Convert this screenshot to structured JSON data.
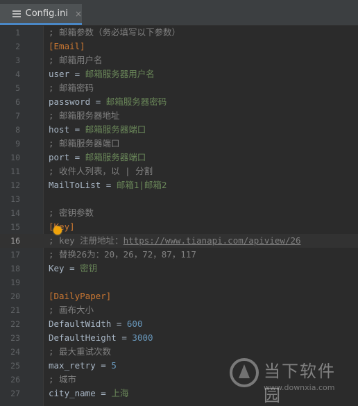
{
  "tab": {
    "title": "Config.ini",
    "close": "×",
    "icon": "ini-file-icon"
  },
  "editor": {
    "current_line": 16,
    "lines": [
      {
        "n": "1",
        "comment": "; 邮箱参数（务必填写以下参数）"
      },
      {
        "n": "2",
        "section": "[Email]"
      },
      {
        "n": "3",
        "comment": "; 邮箱用户名"
      },
      {
        "n": "4",
        "key": "user",
        "eq": " = ",
        "val": "邮箱服务器用户名"
      },
      {
        "n": "5",
        "comment": "; 邮箱密码"
      },
      {
        "n": "6",
        "key": "password",
        "eq": " = ",
        "val": "邮箱服务器密码"
      },
      {
        "n": "7",
        "comment": "; 邮箱服务器地址"
      },
      {
        "n": "8",
        "key": "host",
        "eq": " = ",
        "val": "邮箱服务器端口"
      },
      {
        "n": "9",
        "comment": "; 邮箱服务器端口"
      },
      {
        "n": "10",
        "key": "port",
        "eq": " = ",
        "val": "邮箱服务器端口"
      },
      {
        "n": "11",
        "comment": "; 收件人列表，以 | 分割"
      },
      {
        "n": "12",
        "key": "MailToList",
        "eq": " = ",
        "val": "邮箱1|邮箱2"
      },
      {
        "n": "13"
      },
      {
        "n": "14",
        "comment": "; 密钥参数"
      },
      {
        "n": "15",
        "section": "[Key]"
      },
      {
        "n": "16",
        "comment": "; key 注册地址：",
        "url": "https://www.tianapi.com/apiview/26"
      },
      {
        "n": "17",
        "comment": "; 替换26为：20，26，72，87，117"
      },
      {
        "n": "18",
        "key": "Key",
        "eq": " = ",
        "val": "密钥"
      },
      {
        "n": "19"
      },
      {
        "n": "20",
        "section": "[DailyPaper]"
      },
      {
        "n": "21",
        "comment": "; 画布大小"
      },
      {
        "n": "22",
        "key": "DefaultWidth",
        "eq": " = ",
        "num": "600"
      },
      {
        "n": "23",
        "key": "DefaultHeight",
        "eq": " = ",
        "num": "3000"
      },
      {
        "n": "24",
        "comment": "; 最大重试次数"
      },
      {
        "n": "25",
        "key": "max_retry",
        "eq": " = ",
        "num": "5"
      },
      {
        "n": "26",
        "comment": "; 城市"
      },
      {
        "n": "27",
        "key": "city_name",
        "eq": " = ",
        "val": "上海"
      }
    ]
  },
  "watermark": {
    "text": "当下软件园",
    "url": "www.downxia.com"
  },
  "colors": {
    "comment": "#808080",
    "section": "#cc7832",
    "string": "#6a8759",
    "number": "#6897bb",
    "background": "#2b2b2b"
  }
}
